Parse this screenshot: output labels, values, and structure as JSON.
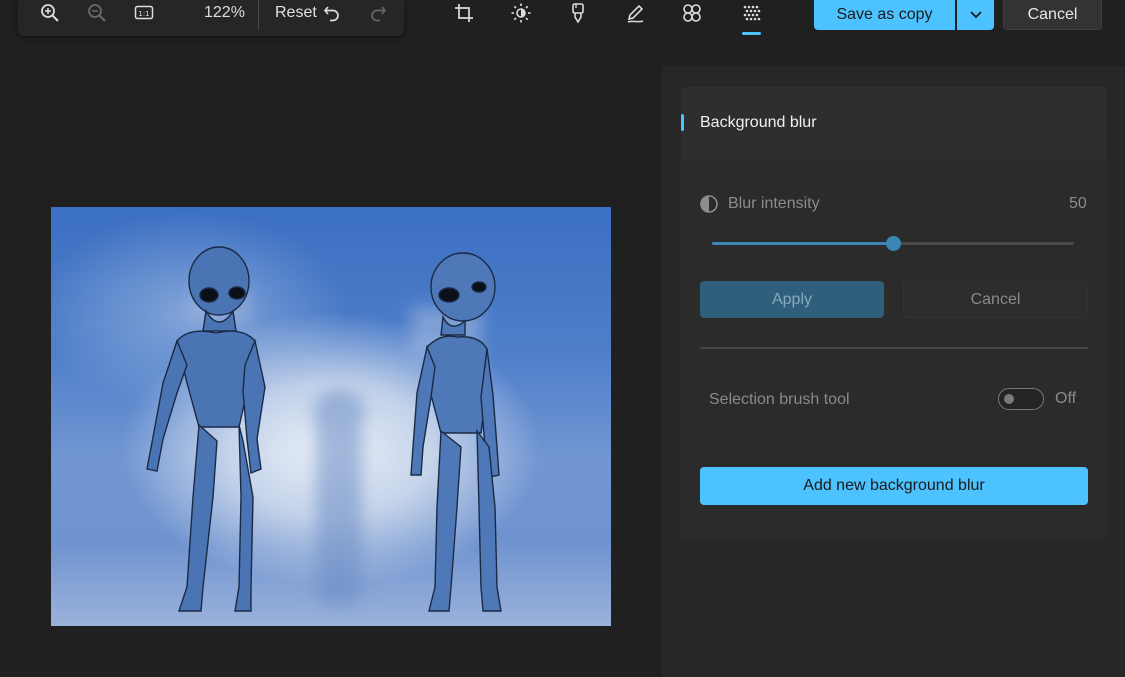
{
  "toolbar": {
    "zoom_level": "122%",
    "reset_label": "Reset",
    "icons": [
      "zoom-in-icon",
      "zoom-out-icon",
      "actual-size-icon",
      "undo-icon",
      "redo-icon"
    ]
  },
  "tools": {
    "items": [
      "crop-icon",
      "adjustment-icon",
      "filter-icon",
      "markup-icon",
      "retouch-icon",
      "background-blur-icon"
    ],
    "active": "background-blur-icon"
  },
  "actions": {
    "save_label": "Save as copy",
    "cancel_label": "Cancel"
  },
  "panel": {
    "title": "Background blur",
    "intensity_label": "Blur intensity",
    "intensity_value": "50",
    "intensity_fraction": 0.5,
    "apply_label": "Apply",
    "cancel_label": "Cancel",
    "brush_label": "Selection brush tool",
    "brush_state": "Off",
    "add_label": "Add new background blur"
  },
  "colors": {
    "accent": "#4cc2ff",
    "background": "#202020",
    "panel": "#272727"
  }
}
